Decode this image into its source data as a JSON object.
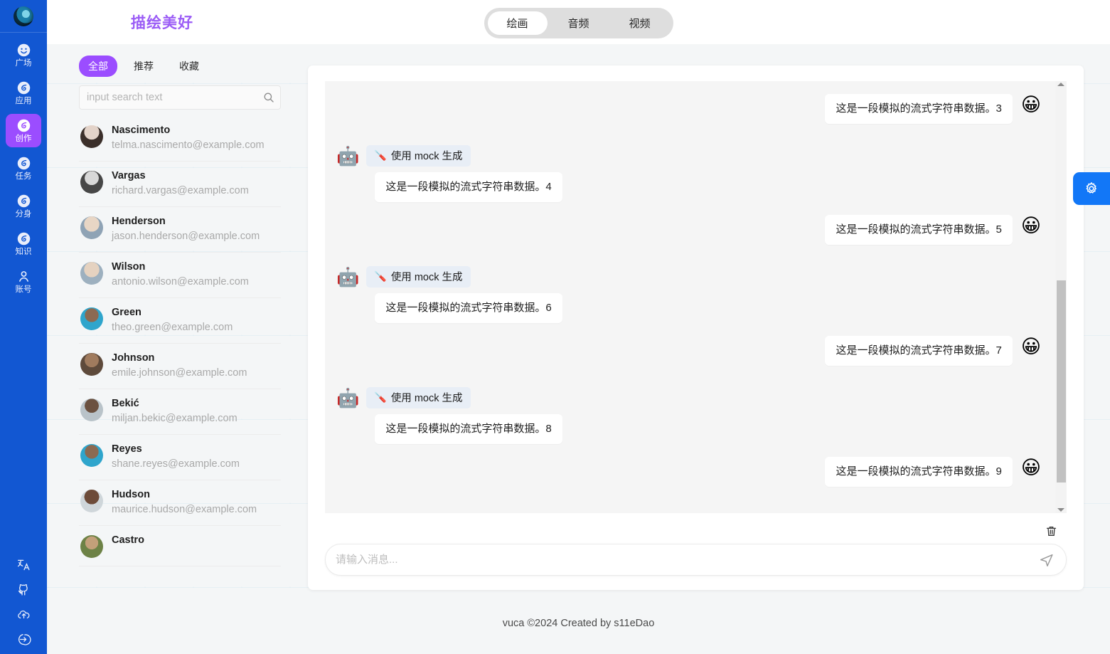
{
  "accent": {
    "brand_purple": "#9b5cf6",
    "sidebar_blue": "#1257d2",
    "active_purple": "#9b4dff",
    "fab_blue": "#1277f7"
  },
  "sidebar": {
    "logo_icon": "globe-avatar-icon",
    "items": [
      {
        "label": "广场",
        "icon": "smiley-icon",
        "active": false
      },
      {
        "label": "应用",
        "icon": "swirl-icon",
        "active": false
      },
      {
        "label": "创作",
        "icon": "swirl-icon",
        "active": true
      },
      {
        "label": "任务",
        "icon": "swirl-icon",
        "active": false
      },
      {
        "label": "分身",
        "icon": "swirl-icon",
        "active": false
      },
      {
        "label": "知识",
        "icon": "swirl-icon",
        "active": false
      },
      {
        "label": "账号",
        "icon": "user-icon",
        "active": false
      }
    ],
    "bottom_icons": [
      "translate-icon",
      "github-icon",
      "cloud-upload-icon",
      "logout-icon"
    ]
  },
  "header": {
    "brand": "描绘美好",
    "tabs": [
      {
        "label": "绘画",
        "active": true
      },
      {
        "label": "音频",
        "active": false
      },
      {
        "label": "视频",
        "active": false
      }
    ]
  },
  "contacts_panel": {
    "filter_tabs": [
      {
        "label": "全部",
        "active": true
      },
      {
        "label": "推荐",
        "active": false
      },
      {
        "label": "收藏",
        "active": false
      }
    ],
    "search": {
      "value": "",
      "placeholder": "input search text",
      "icon": "search-icon"
    },
    "items": [
      {
        "name": "Nascimento",
        "email": "telma.nascimento@example.com",
        "avatar": "#c9b6ad"
      },
      {
        "name": "Vargas",
        "email": "richard.vargas@example.com",
        "avatar": "#9a9a9a"
      },
      {
        "name": "Henderson",
        "email": "jason.henderson@example.com",
        "avatar": "#cdbcb0"
      },
      {
        "name": "Wilson",
        "email": "antonio.wilson@example.com",
        "avatar": "#c3b6a8"
      },
      {
        "name": "Green",
        "email": "theo.green@example.com",
        "avatar": "#3aa6c8"
      },
      {
        "name": "Johnson",
        "email": "emile.johnson@example.com",
        "avatar": "#6b5a4a"
      },
      {
        "name": "Bekić",
        "email": "miljan.bekic@example.com",
        "avatar": "#7d7263"
      },
      {
        "name": "Reyes",
        "email": "shane.reyes@example.com",
        "avatar": "#3aa0c4"
      },
      {
        "name": "Hudson",
        "email": "maurice.hudson@example.com",
        "avatar": "#6a4b3c"
      },
      {
        "name": "Castro",
        "email": "",
        "avatar": "#8a9a5b"
      }
    ]
  },
  "chat": {
    "bot_avatar_icon": "robot-emoji",
    "user_avatar_icon": "grinning-face-emoji",
    "bot_badge": {
      "icon": "mechanical-arm-emoji",
      "label": "使用 mock 生成"
    },
    "messages": [
      {
        "role": "user",
        "text": "这是一段模拟的流式字符串数据。3"
      },
      {
        "role": "bot",
        "text": "这是一段模拟的流式字符串数据。4"
      },
      {
        "role": "user",
        "text": "这是一段模拟的流式字符串数据。5"
      },
      {
        "role": "bot",
        "text": "这是一段模拟的流式字符串数据。6"
      },
      {
        "role": "user",
        "text": "这是一段模拟的流式字符串数据。7"
      },
      {
        "role": "bot",
        "text": "这是一段模拟的流式字符串数据。8"
      },
      {
        "role": "user",
        "text": "这是一段模拟的流式字符串数据。9"
      }
    ],
    "clear_icon": "trash-icon",
    "composer": {
      "value": "",
      "placeholder": "请输入消息...",
      "send_icon": "send-icon"
    }
  },
  "floating": {
    "settings_icon": "gear-icon"
  },
  "footer": {
    "text": "vuca ©2024 Created by s11eDao"
  }
}
